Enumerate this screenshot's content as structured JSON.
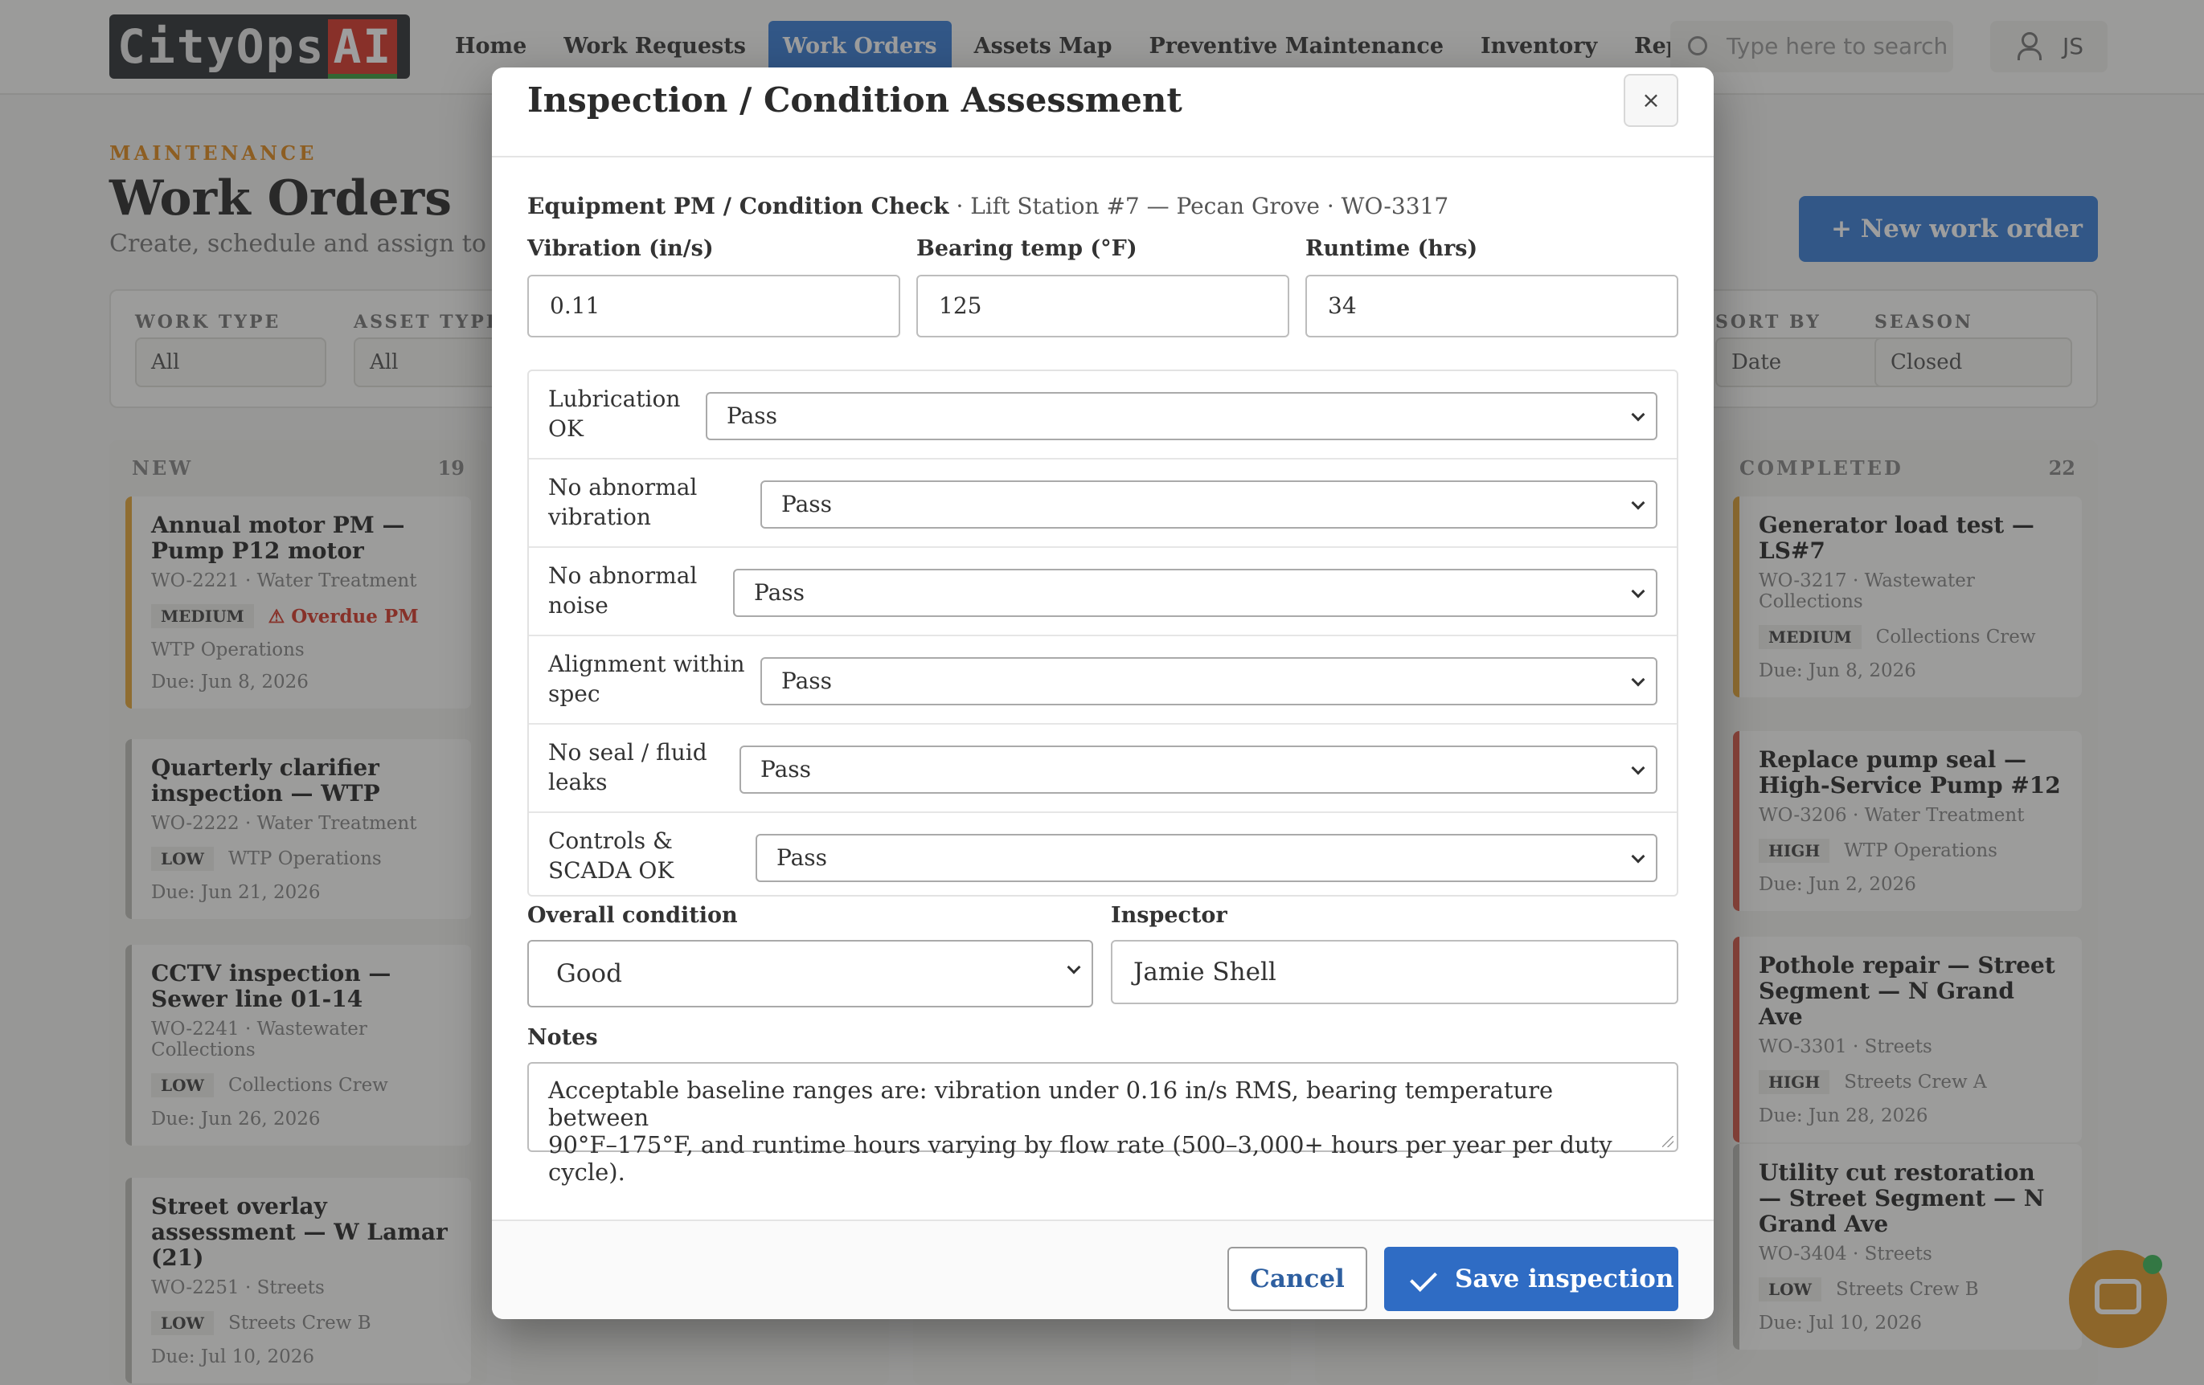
{
  "app": {
    "logo_text": "CityOps",
    "logo_ai": "AI",
    "nav": [
      "Home",
      "Work Requests",
      "Work Orders",
      "Assets Map",
      "Preventive Maintenance",
      "Inventory",
      "Reports"
    ],
    "search_placeholder": "Type here to search",
    "user_initials": "JS"
  },
  "page": {
    "eyebrow": "MAINTENANCE",
    "title": "Work Orders",
    "subtitle": "Create, schedule and assign to crews",
    "new_button": "+ New work order",
    "filters": [
      {
        "label": "WORK TYPE",
        "value": "All"
      },
      {
        "label": "ASSET TYPE",
        "value": "All"
      },
      {
        "label": "SORT BY",
        "value": "Date"
      },
      {
        "label": "SEASON",
        "value": "Closed"
      }
    ]
  },
  "board": {
    "new_column": {
      "title": "NEW",
      "count": "19",
      "cards": [
        {
          "title": "Annual motor PM — Pump P12 motor",
          "meta": "WO-2221 · Water Treatment",
          "tag": "MEDIUM",
          "extra": "⚠ Overdue PM",
          "team": "WTP Operations",
          "due": "Due: Jun 8, 2026"
        },
        {
          "title": "Quarterly clarifier inspection — WTP",
          "meta": "WO-2222 · Water Treatment",
          "tag": "LOW",
          "team": "WTP Operations",
          "due": "Due: Jun 21, 2026"
        },
        {
          "title": "CCTV inspection — Sewer line 01-14",
          "meta": "WO-2241 · Wastewater Collections",
          "tag": "LOW",
          "team": "Collections Crew",
          "due": "Due: Jun 26, 2026"
        },
        {
          "title": "Street overlay assessment — W Lamar (21)",
          "meta": "WO-2251 · Streets",
          "tag": "LOW",
          "team": "Streets Crew B",
          "due": "Due: Jul 10, 2026"
        }
      ]
    },
    "completed_column": {
      "title": "COMPLETED",
      "count": "22",
      "cards": [
        {
          "title": "Generator load test — LS#7",
          "meta": "WO-3217 · Wastewater Collections",
          "tag": "MEDIUM",
          "team": "Collections Crew",
          "due": "Due: Jun 8, 2026"
        },
        {
          "title": "Replace pump seal — High-Service Pump #12",
          "meta": "WO-3206 · Water Treatment",
          "tag": "HIGH",
          "team": "WTP Operations",
          "due": "Due: Jun 2, 2026"
        },
        {
          "title": "Pothole repair — Street Segment — N Grand Ave",
          "meta": "WO-3301 · Streets",
          "tag": "HIGH",
          "team": "Streets Crew A",
          "due": "Due: Jun 28, 2026"
        },
        {
          "title": "Utility cut restoration — Street Segment — N Grand Ave",
          "meta": "WO-3404 · Streets",
          "tag": "LOW",
          "team": "Streets Crew B",
          "due": "Due: Jul 10, 2026"
        }
      ]
    }
  },
  "modal": {
    "title": "Inspection / Condition Assessment",
    "close_label": "×",
    "sub_bold": "Equipment PM / Condition Check",
    "sub_rest": " · Lift Station #7 — Pecan Grove · WO-3317",
    "fields": {
      "vibration_label": "Vibration (in/s)",
      "vibration_value": "0.11",
      "bearing_label": "Bearing temp (°F)",
      "bearing_value": "125",
      "runtime_label": "Runtime (hrs)",
      "runtime_value": "34"
    },
    "checklist": [
      {
        "label": "Lubrication\nOK",
        "value": "Pass"
      },
      {
        "label": "No abnormal\nvibration",
        "value": "Pass"
      },
      {
        "label": "No abnormal\nnoise",
        "value": "Pass"
      },
      {
        "label": "Alignment within\nspec",
        "value": "Pass"
      },
      {
        "label": "No seal / fluid\nleaks",
        "value": "Pass"
      },
      {
        "label": "Controls &\nSCADA OK",
        "value": "Pass"
      }
    ],
    "overall_label": "Overall condition",
    "overall_value": "Good",
    "inspector_label": "Inspector",
    "inspector_value": "Jamie Shell",
    "notes_label": "Notes",
    "notes_value": "Acceptable baseline ranges are: vibration under 0.16 in/s RMS, bearing temperature between\n90°F–175°F, and runtime hours varying by flow rate (500–3,000+ hours per year per duty cycle).",
    "cancel_label": "Cancel",
    "save_label": "Save inspection"
  },
  "colors": {
    "primary": "#2f6cc4",
    "accent_orange": "#e08a1e",
    "overdue_red": "#d53a2a"
  }
}
